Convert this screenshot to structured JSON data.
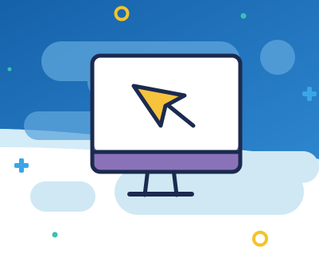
{
  "illustration": {
    "subject": "desktop-monitor-with-cursor",
    "icons": [
      "monitor-icon",
      "cursor-arrow-icon",
      "plus-icon",
      "ring-icon",
      "dot-icon",
      "cloud-icon"
    ]
  },
  "colors": {
    "sky_dark": "#1561a9",
    "sky_light": "#2d86cf",
    "cloud_blue": "#6aaedf",
    "cloud_white": "#d9eef7",
    "ground": "#ffffff",
    "outline": "#1b2a4e",
    "screen": "#ffffff",
    "screen_base": "#8a72b8",
    "cursor_fill": "#f7c33d",
    "ring": "#f4c32a",
    "plus": "#3aa6e5",
    "dot": "#3dbfb4"
  }
}
